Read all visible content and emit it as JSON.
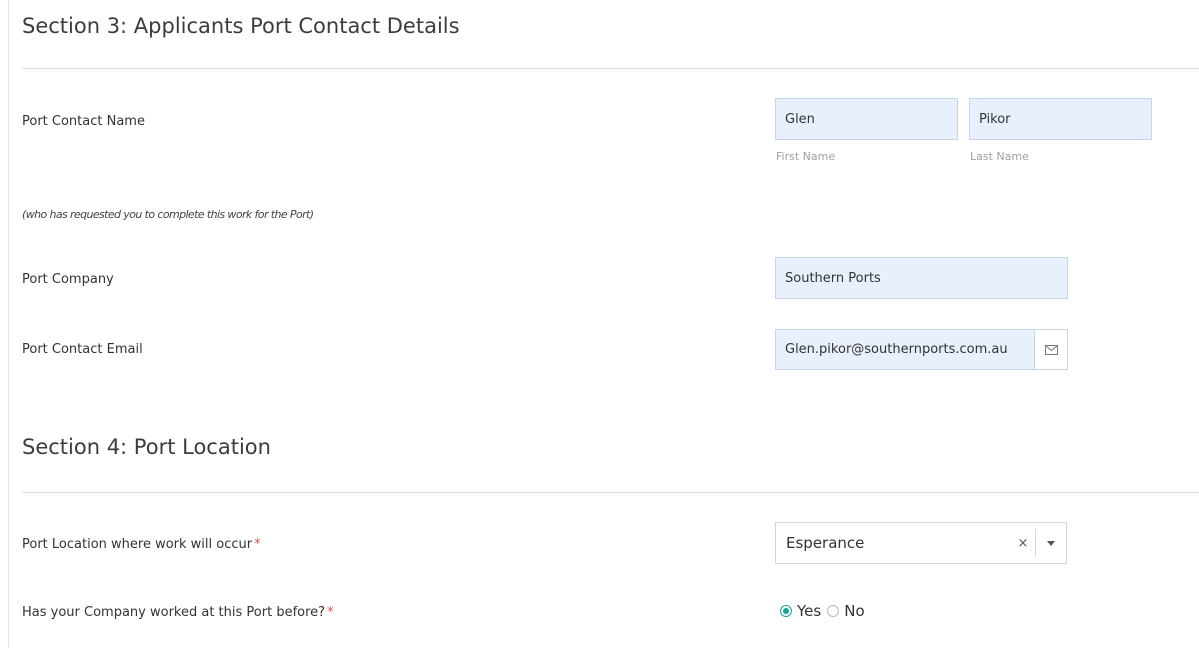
{
  "section3": {
    "title": "Section 3: Applicants Port Contact Details",
    "contact_name": {
      "label": "Port Contact Name",
      "first_value": "Glen",
      "first_sublabel": "First Name",
      "last_value": "Pikor",
      "last_sublabel": "Last Name"
    },
    "note": "(who has requested you to complete this work for the Port)",
    "company": {
      "label": "Port Company",
      "value": "Southern Ports"
    },
    "email": {
      "label": "Port Contact Email",
      "value": "Glen.pikor@southernports.com.au",
      "icon": "envelope-icon"
    }
  },
  "section4": {
    "title": "Section 4: Port Location",
    "location": {
      "label": "Port Location where work will occur",
      "required_mark": "*",
      "selected": "Esperance",
      "clear_glyph": "×"
    },
    "worked_before": {
      "label": "Has your Company worked at this Port before?",
      "required_mark": "*",
      "options": [
        "Yes",
        "No"
      ],
      "selected": "Yes"
    }
  },
  "colors": {
    "field_bg": "#e8f0fe",
    "accent": "#1aa39a",
    "required": "#d9534f"
  }
}
